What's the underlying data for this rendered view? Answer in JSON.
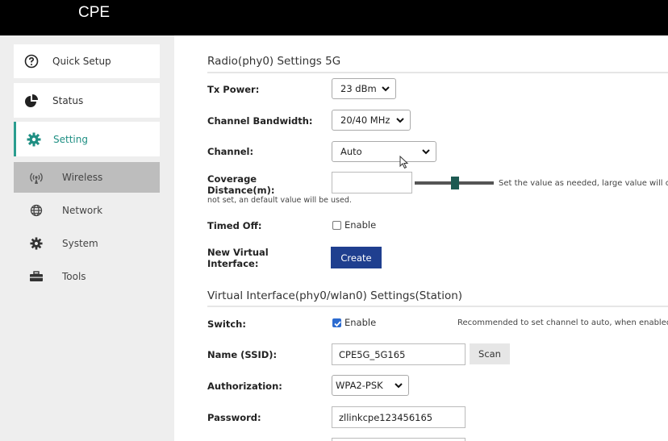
{
  "app": {
    "brand": "CPE"
  },
  "sidebar": {
    "items": [
      {
        "label": "Quick Setup",
        "icon": "help-circle-icon"
      },
      {
        "label": "Status",
        "icon": "pie-chart-icon"
      },
      {
        "label": "Setting",
        "icon": "gear-icon",
        "active": true
      }
    ],
    "subitems": [
      {
        "label": "Wireless",
        "icon": "antenna-icon",
        "selected": true
      },
      {
        "label": "Network",
        "icon": "globe-icon"
      },
      {
        "label": "System",
        "icon": "gear-icon"
      },
      {
        "label": "Tools",
        "icon": "toolbox-icon"
      }
    ]
  },
  "radio": {
    "title": "Radio(phy0) Settings 5G",
    "tx_power": {
      "label": "Tx Power:",
      "value": "23 dBm"
    },
    "bandwidth": {
      "label": "Channel Bandwidth:",
      "value": "20/40 MHz"
    },
    "channel": {
      "label": "Channel:",
      "value": "Auto"
    },
    "coverage": {
      "label_line1": "Coverage",
      "label_line2": "Distance(m):",
      "value": "",
      "hint_right": "Set the value as needed, large value will c",
      "hint_below": "not set, an default value will be used."
    },
    "timed_off": {
      "label": "Timed Off:",
      "checkbox_label": "Enable",
      "checked": false
    },
    "new_vif": {
      "label_line1": "New Virtual",
      "label_line2": "Interface:",
      "button": "Create"
    }
  },
  "vif": {
    "title": "Virtual Interface(phy0/wlan0) Settings(Station)",
    "switch": {
      "label": "Switch:",
      "checkbox_label": "Enable",
      "checked": true,
      "note": "Recommended to set channel to auto, when enabled"
    },
    "ssid": {
      "label": "Name (SSID):",
      "value": "CPE5G_5G165",
      "scan_button": "Scan"
    },
    "auth": {
      "label": "Authorization:",
      "value": "WPA2-PSK"
    },
    "password": {
      "label": "Password:",
      "value": "zllinkcpe123456165"
    }
  },
  "colors": {
    "topbar": "#000000",
    "accent": "#2a9d8f",
    "create_button": "#1f3f8f",
    "checkbox_on": "#2c6bd0"
  }
}
